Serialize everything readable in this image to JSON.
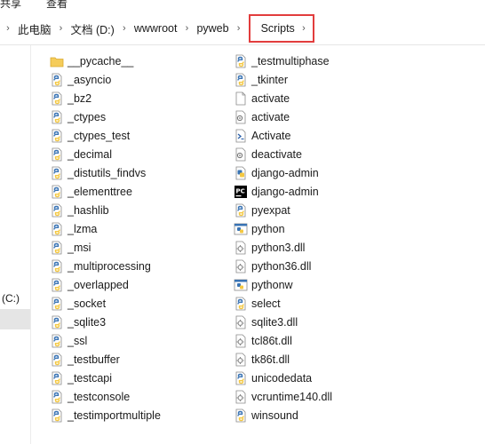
{
  "ribbon": {
    "tabs": [
      "共享",
      "查看"
    ]
  },
  "addressbar": {
    "crumbs": [
      "此电脑",
      "文档 (D:)",
      "wwwroot",
      "pyweb",
      "Scripts"
    ]
  },
  "nav": {
    "drive_label": "(C:)"
  },
  "files": {
    "col1": [
      {
        "name": "__pycache__",
        "icon": "folder-icon"
      },
      {
        "name": "_asyncio",
        "icon": "python-file-icon"
      },
      {
        "name": "_bz2",
        "icon": "python-file-icon"
      },
      {
        "name": "_ctypes",
        "icon": "python-file-icon"
      },
      {
        "name": "_ctypes_test",
        "icon": "python-file-icon"
      },
      {
        "name": "_decimal",
        "icon": "python-file-icon"
      },
      {
        "name": "_distutils_findvs",
        "icon": "python-file-icon"
      },
      {
        "name": "_elementtree",
        "icon": "python-file-icon"
      },
      {
        "name": "_hashlib",
        "icon": "python-file-icon"
      },
      {
        "name": "_lzma",
        "icon": "python-file-icon"
      },
      {
        "name": "_msi",
        "icon": "python-file-icon"
      },
      {
        "name": "_multiprocessing",
        "icon": "python-file-icon"
      },
      {
        "name": "_overlapped",
        "icon": "python-file-icon"
      },
      {
        "name": "_socket",
        "icon": "python-file-icon"
      },
      {
        "name": "_sqlite3",
        "icon": "python-file-icon"
      },
      {
        "name": "_ssl",
        "icon": "python-file-icon"
      },
      {
        "name": "_testbuffer",
        "icon": "python-file-icon"
      },
      {
        "name": "_testcapi",
        "icon": "python-file-icon"
      },
      {
        "name": "_testconsole",
        "icon": "python-file-icon"
      },
      {
        "name": "_testimportmultiple",
        "icon": "python-file-icon"
      }
    ],
    "col2": [
      {
        "name": "_testmultiphase",
        "icon": "python-file-icon"
      },
      {
        "name": "_tkinter",
        "icon": "python-file-icon"
      },
      {
        "name": "activate",
        "icon": "blank-file-icon"
      },
      {
        "name": "activate",
        "icon": "batch-file-icon"
      },
      {
        "name": "Activate",
        "icon": "powershell-file-icon"
      },
      {
        "name": "deactivate",
        "icon": "batch-file-icon"
      },
      {
        "name": "django-admin",
        "icon": "python-script-icon"
      },
      {
        "name": "django-admin",
        "icon": "pycharm-icon"
      },
      {
        "name": "pyexpat",
        "icon": "python-file-icon"
      },
      {
        "name": "python",
        "icon": "python-exe-icon"
      },
      {
        "name": "python3.dll",
        "icon": "dll-file-icon"
      },
      {
        "name": "python36.dll",
        "icon": "dll-file-icon"
      },
      {
        "name": "pythonw",
        "icon": "python-exe-icon"
      },
      {
        "name": "select",
        "icon": "python-file-icon"
      },
      {
        "name": "sqlite3.dll",
        "icon": "dll-file-icon"
      },
      {
        "name": "tcl86t.dll",
        "icon": "dll-file-icon"
      },
      {
        "name": "tk86t.dll",
        "icon": "dll-file-icon"
      },
      {
        "name": "unicodedata",
        "icon": "python-file-icon"
      },
      {
        "name": "vcruntime140.dll",
        "icon": "dll-file-icon"
      },
      {
        "name": "winsound",
        "icon": "python-file-icon"
      }
    ]
  },
  "colors": {
    "highlight_border": "#e23d3d",
    "nav_selected": "#e5e5e5",
    "folder": "#f5cc5a",
    "python_blue": "#3a74b4",
    "python_yellow": "#f4c842"
  }
}
